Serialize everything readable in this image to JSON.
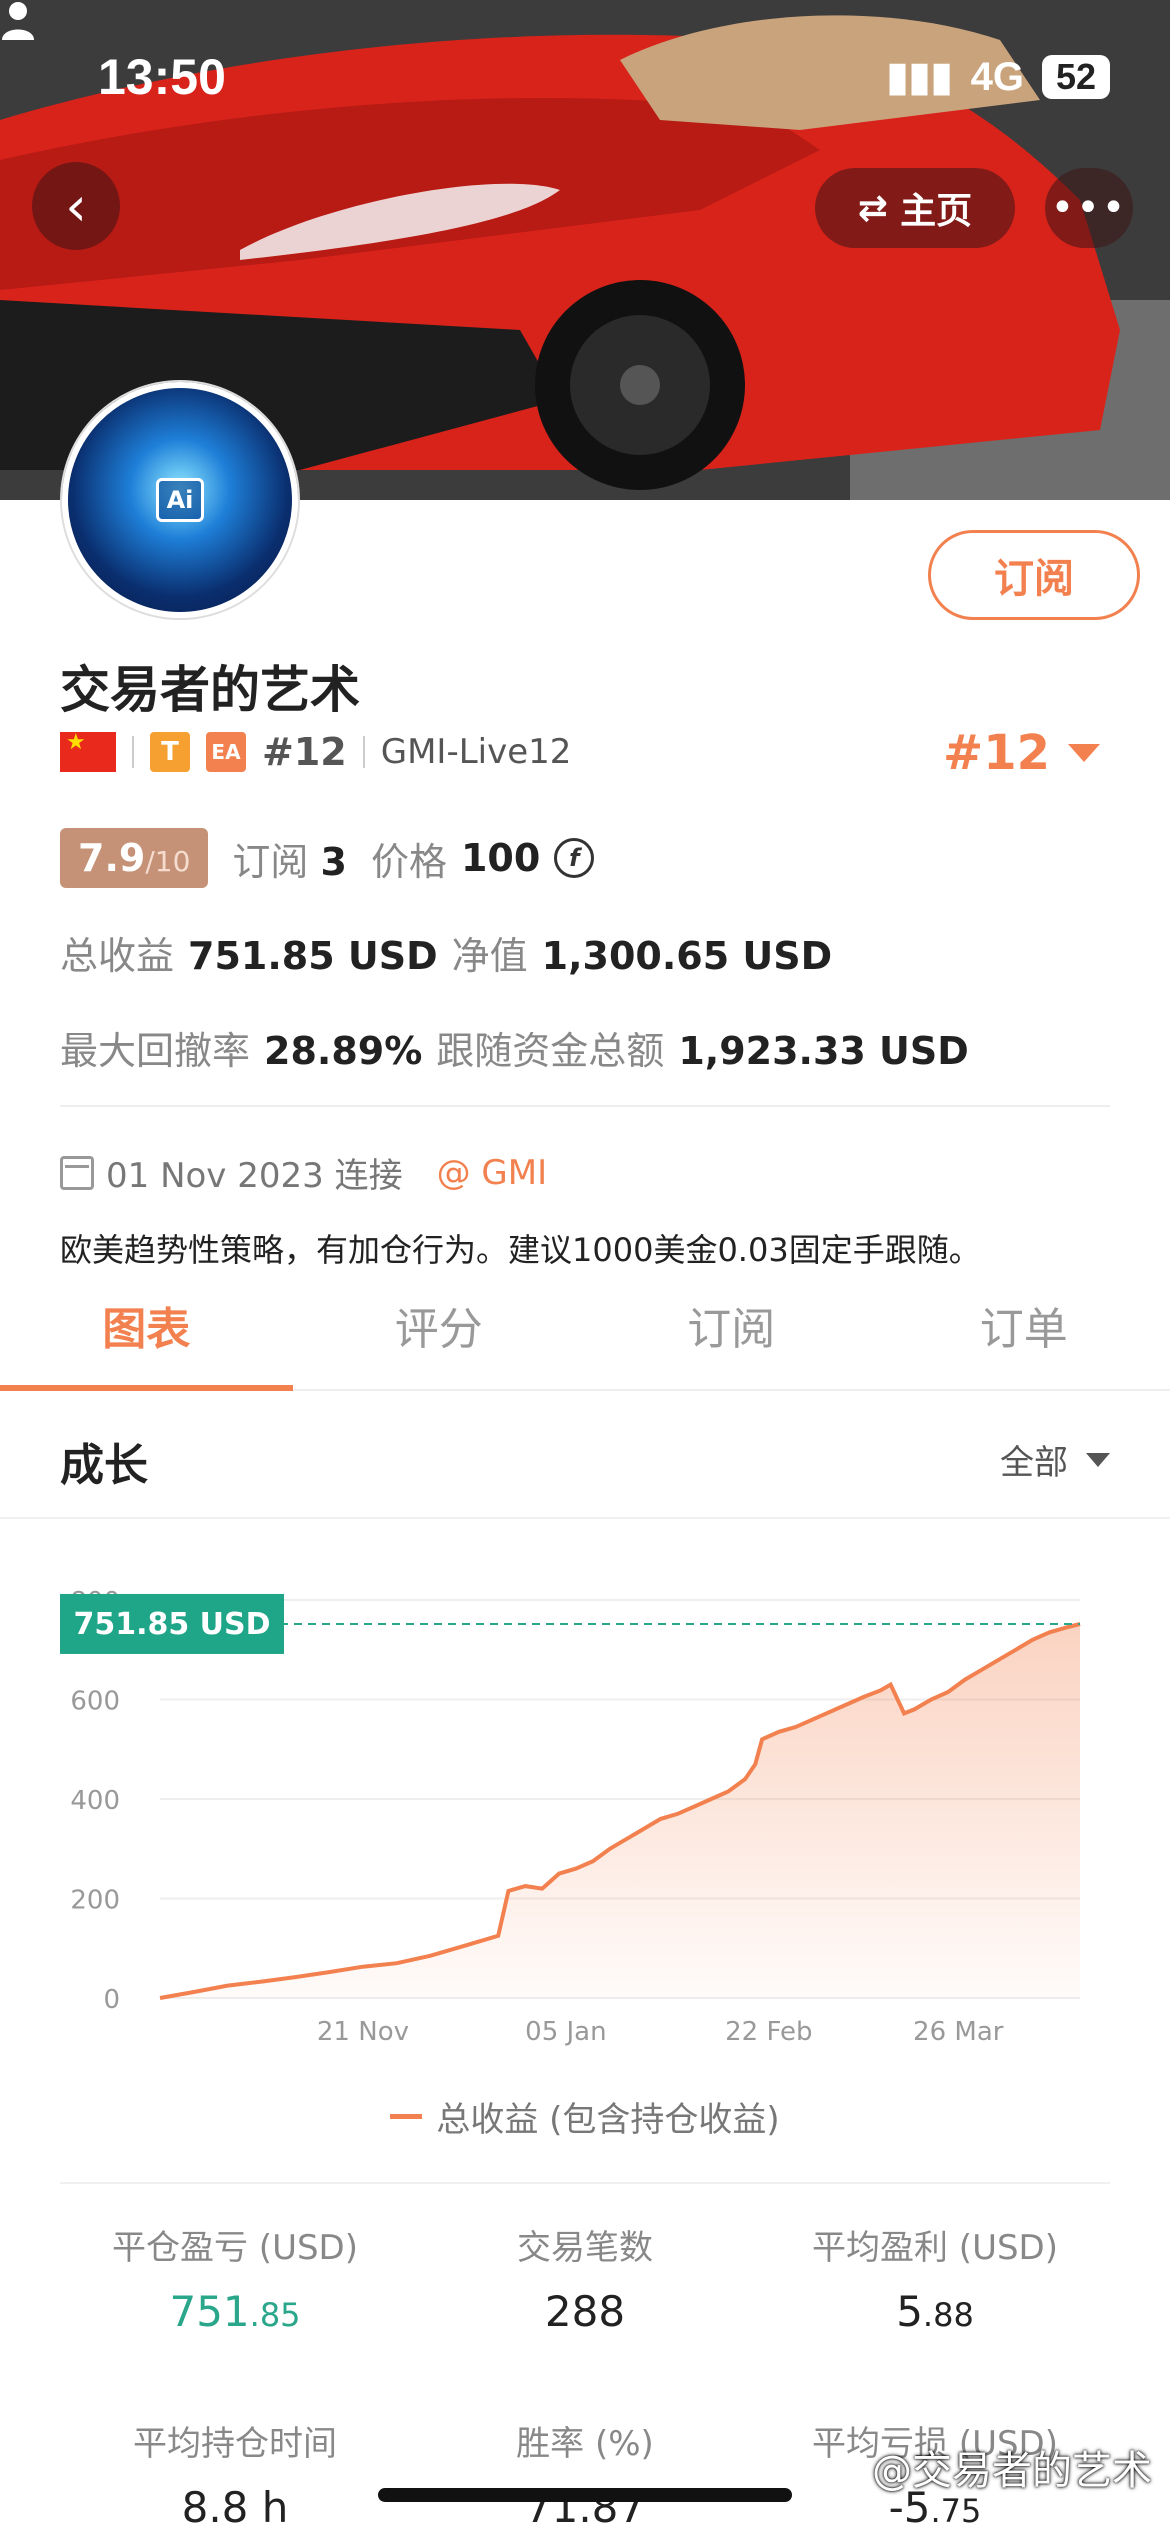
{
  "status_bar": {
    "time": "13:50",
    "network": "4G",
    "battery": "52"
  },
  "nav": {
    "home_label": "主页",
    "more_label": "•••"
  },
  "profile": {
    "avatar_text": "Ai",
    "name": "交易者的艺术",
    "badge_t": "T",
    "badge_ea": "EA",
    "rank_small": "#12",
    "server": "GMI-Live12",
    "rank_big": "#12",
    "subscribe_label": "订阅"
  },
  "score": {
    "value": "7.9",
    "max": "/10",
    "subscribers_label": "订阅",
    "subscribers": "3",
    "price_label": "价格",
    "price": "100",
    "coin_symbol": "f"
  },
  "stats": {
    "total_profit_label": "总收益",
    "total_profit": "751.85 USD",
    "equity_label": "净值",
    "equity": "1,300.65 USD",
    "max_drawdown_label": "最大回撤率",
    "max_drawdown": "28.89%",
    "follow_funds_label": "跟随资金总额",
    "follow_funds": "1,923.33 USD"
  },
  "connection": {
    "date_text": "01 Nov 2023 连接",
    "broker": "@ GMI"
  },
  "description": "欧美趋势性策略，有加仓行为。建议1000美金0.03固定手跟随。",
  "tabs": [
    "图表",
    "评分",
    "订阅",
    "订单"
  ],
  "growth": {
    "title": "成长",
    "filter": "全部"
  },
  "chart_data": {
    "type": "area",
    "current_label": "751.85 USD",
    "current_value": 751.85,
    "ylim": [
      0,
      800
    ],
    "y_ticks": [
      "0",
      "200",
      "400",
      "600",
      "800"
    ],
    "x_ticks": [
      "21 Nov",
      "05 Jan",
      "22 Feb",
      "26 Mar"
    ],
    "series": [
      {
        "name": "总收益 (包含持仓收益)",
        "color": "#f2814f",
        "points": [
          [
            0,
            0
          ],
          [
            10,
            12
          ],
          [
            20,
            25
          ],
          [
            30,
            33
          ],
          [
            40,
            42
          ],
          [
            50,
            52
          ],
          [
            60,
            63
          ],
          [
            70,
            70
          ],
          [
            80,
            85
          ],
          [
            90,
            105
          ],
          [
            100,
            125
          ],
          [
            103,
            215
          ],
          [
            108,
            225
          ],
          [
            113,
            220
          ],
          [
            118,
            250
          ],
          [
            123,
            260
          ],
          [
            128,
            275
          ],
          [
            133,
            300
          ],
          [
            138,
            320
          ],
          [
            143,
            340
          ],
          [
            148,
            360
          ],
          [
            153,
            370
          ],
          [
            158,
            385
          ],
          [
            163,
            400
          ],
          [
            168,
            415
          ],
          [
            173,
            440
          ],
          [
            176,
            470
          ],
          [
            178,
            520
          ],
          [
            183,
            535
          ],
          [
            188,
            545
          ],
          [
            193,
            560
          ],
          [
            198,
            575
          ],
          [
            203,
            590
          ],
          [
            208,
            605
          ],
          [
            213,
            618
          ],
          [
            216,
            630
          ],
          [
            220,
            572
          ],
          [
            223,
            580
          ],
          [
            228,
            600
          ],
          [
            233,
            615
          ],
          [
            238,
            640
          ],
          [
            243,
            660
          ],
          [
            248,
            680
          ],
          [
            253,
            700
          ],
          [
            258,
            720
          ],
          [
            263,
            735
          ],
          [
            268,
            745
          ],
          [
            272,
            751.85
          ]
        ]
      }
    ],
    "x_range": [
      0,
      272
    ],
    "x_tick_positions": [
      60,
      120,
      180,
      236
    ]
  },
  "legend_label": "总收益 (包含持仓收益)",
  "metrics": [
    {
      "label": "平仓盈亏 (USD)",
      "int": "751",
      "dec": ".85",
      "color": "green"
    },
    {
      "label": "交易笔数",
      "int": "288",
      "dec": ""
    },
    {
      "label": "平均盈利 (USD)",
      "int": "5",
      "dec": ".88"
    },
    {
      "label": "平均持仓时间",
      "int": "8.8 h",
      "dec": ""
    },
    {
      "label": "胜率 (%)",
      "int": "71.87",
      "dec": ""
    },
    {
      "label": "平均亏损 (USD)",
      "int": "-5",
      "dec": ".75"
    }
  ],
  "watermark": "@交易者的艺术"
}
